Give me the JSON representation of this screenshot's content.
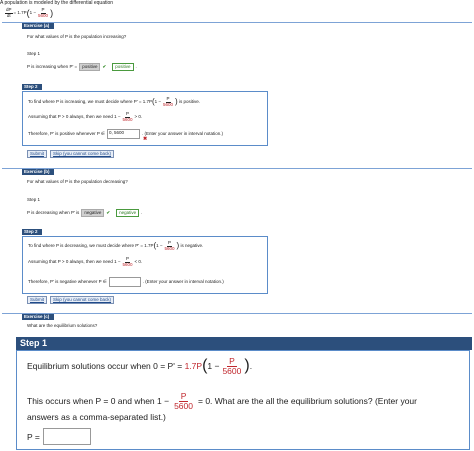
{
  "top": {
    "intro": "A population is modeled by the differential equation",
    "eq_lhs_num": "dP",
    "eq_lhs_den": "dt",
    "eq_rhs": "= 1.7P",
    "eq_frac_num": "P",
    "eq_frac_den": "5600"
  },
  "ex_a": {
    "header": "Exercise (a)",
    "question": "For what values of P is the population increasing?",
    "step1_label": "Step 1",
    "step1_text": "P is increasing when P' =",
    "step1_word": "positive",
    "step1_badge": "positive",
    "step2_label": "Step 2",
    "step2_line1": "To find where P is increasing, we must decide where P' = 1.7P",
    "step2_line1_end": "is positive.",
    "step2_line2": "Assuming that P > 0 always, then we need 1 −",
    "step2_line2_end": "> 0.",
    "step2_line3": "Therefore, P' is positive whenever P ∈",
    "step2_input_value": "0, 5600",
    "step2_note": ". (Enter your answer in interval notation.)",
    "submit": "Submit",
    "skip": "Skip (you cannot come back)"
  },
  "ex_b": {
    "header": "Exercise (b)",
    "question": "For what values of P is the population decreasing?",
    "step1_label": "Step 1",
    "step1_text": "P is decreasing when P' is",
    "step1_word": "negative",
    "step1_badge": "negative",
    "step2_label": "Step 2",
    "step2_line1": "To find where P is decreasing, we must decide where P' = 1.7P",
    "step2_line1_end": "is negative.",
    "step2_line2": "Assuming that P > 0 always, then we need 1 −",
    "step2_line2_end": "< 0.",
    "step2_line3": "Therefore, P' is negative whenever P ∈",
    "step2_input_value": "",
    "step2_note": ". (Enter your answer in interval notation.)",
    "submit": "Submit",
    "skip": "Skip (you cannot come back)"
  },
  "ex_c": {
    "header": "Exercise (c)",
    "question": "What are the equilibrium solutions?",
    "step1_label": "Step 1",
    "line1": "Equilibrium solutions occur when 0 = P' =",
    "line1_red": "1.7P",
    "frac_num": "P",
    "frac_den": "5600",
    "line2_a": "This occurs when P = 0 and when 1 −",
    "line2_b": "= 0. What are the all the equilibrium solutions? (Enter your",
    "line3": "answers as a comma-separated list.)",
    "p_label": "P ="
  },
  "common": {
    "frac_P": "P",
    "frac_5600": "5600",
    "one_minus": "1 −"
  }
}
